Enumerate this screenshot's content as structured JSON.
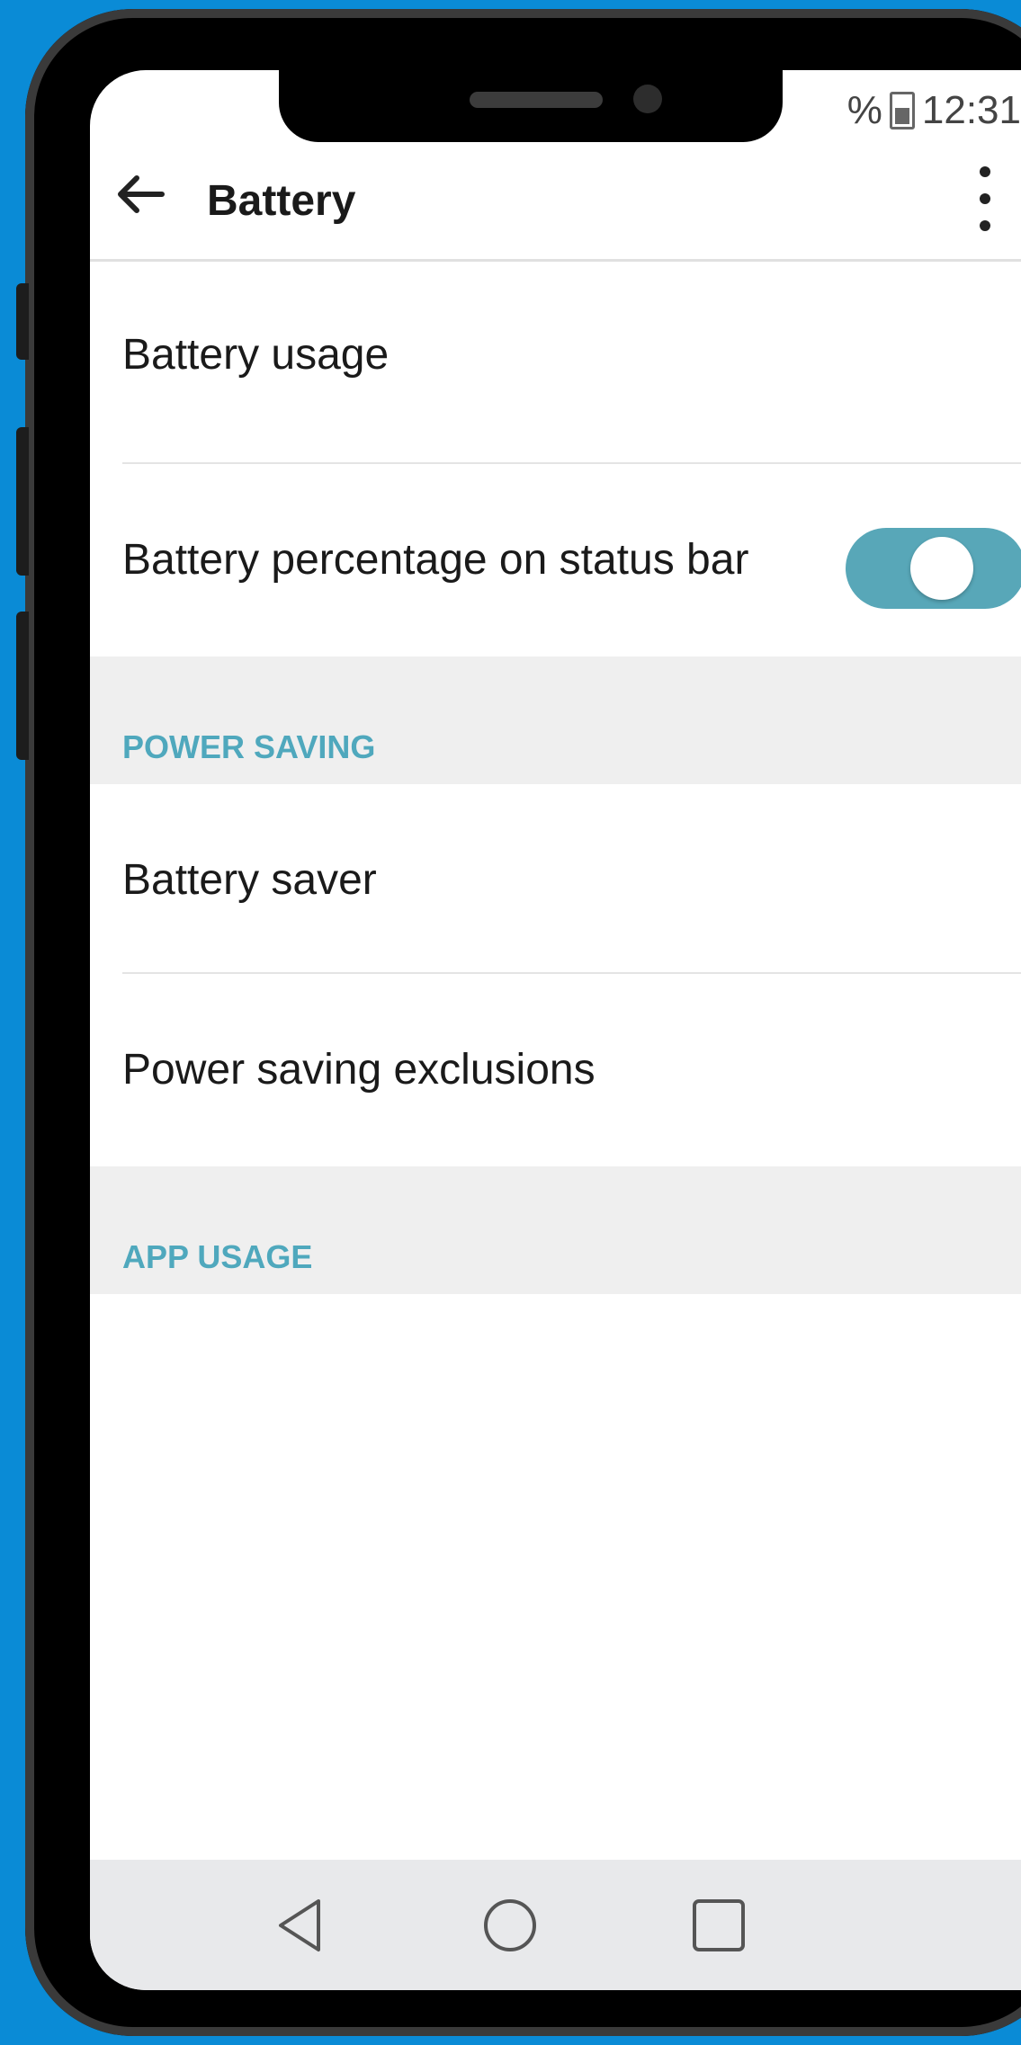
{
  "status_bar": {
    "battery_text": "%",
    "time": "12:31"
  },
  "app_bar": {
    "title": "Battery",
    "back_icon": "arrow-left-icon",
    "menu_icon": "more-vert-icon"
  },
  "items": [
    {
      "label": "Battery usage"
    },
    {
      "label": "Battery percentage on status bar",
      "toggle_on": true
    }
  ],
  "sections": [
    {
      "header": "POWER SAVING",
      "items": [
        {
          "label": "Battery saver"
        },
        {
          "label": "Power saving exclusions"
        }
      ]
    },
    {
      "header": "APP USAGE",
      "items": []
    }
  ],
  "nav": {
    "back": "triangle-back-icon",
    "home": "circle-home-icon",
    "recents": "square-recents-icon"
  },
  "colors": {
    "accent": "#4fa8bd",
    "toggle_track": "#58a7b8",
    "background": "#0a8bd6"
  }
}
